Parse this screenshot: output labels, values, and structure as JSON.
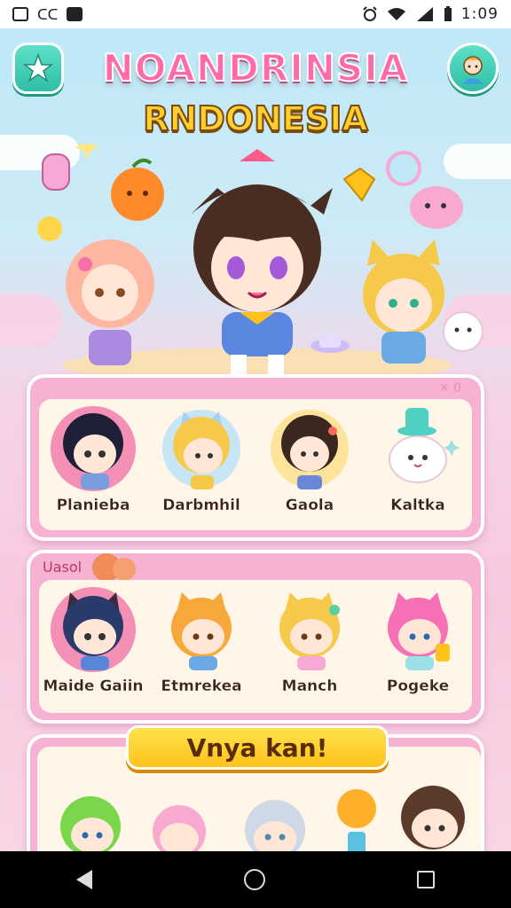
{
  "status_bar": {
    "left_icons": [
      "gallery-icon",
      "cc-icon",
      "app-icon"
    ],
    "left_text": "ᑕᑕ",
    "right_icons": [
      "alarm-icon",
      "wifi-icon",
      "signal-icon",
      "battery-icon"
    ],
    "time": "1:09"
  },
  "header": {
    "title": "NOANDRINSIA",
    "subtitle": "RNDONESIA",
    "left_button_icon": "star-icon",
    "right_button_icon": "profile-icon"
  },
  "card1": {
    "corner_mark": "✕ 0",
    "characters": [
      {
        "label": "Planieba"
      },
      {
        "label": "Darbmhil"
      },
      {
        "label": "Gaola"
      },
      {
        "label": "Kaltka"
      }
    ]
  },
  "card2": {
    "tag": "Uasol",
    "characters": [
      {
        "label": "Maide Gaiin"
      },
      {
        "label": "Etmrekea"
      },
      {
        "label": "Manch"
      },
      {
        "label": "Pogeke"
      }
    ]
  },
  "card3": {
    "button_label": "Vnya kan!"
  },
  "colors": {
    "title_pink": "#ff6aa8",
    "title_yellow": "#ffcf2e",
    "card_pink": "#f7b2d3",
    "card_cream": "#fff6e8",
    "button_yellow": "#ffc21a",
    "teal_button": "#2ebfa6"
  }
}
